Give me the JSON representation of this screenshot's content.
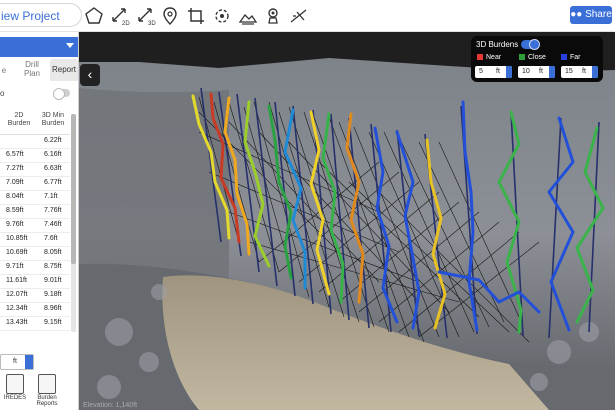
{
  "header": {
    "new_project_label": "iew Project",
    "share_label": "Share",
    "tools": [
      "polygon-tool-icon",
      "measure-2d-icon",
      "measure-3d-icon",
      "pin-icon",
      "crop-icon",
      "rotate-icon",
      "terrain-icon",
      "blast-icon",
      "slope-icon"
    ],
    "tool_labels": {
      "measure2d": "2D",
      "measure3d": "3D"
    }
  },
  "sidebar": {
    "tabs": [
      {
        "label": "e"
      },
      {
        "label": "Drill Plan"
      },
      {
        "label": "Report"
      }
    ],
    "toggle_label": "o",
    "table": {
      "headers": [
        "2D Burden",
        "3D Min Burden"
      ],
      "rows": [
        [
          "",
          "6.22ft"
        ],
        [
          "6.57ft",
          "6.16ft"
        ],
        [
          "7.27ft",
          "6.63ft"
        ],
        [
          "7.09ft",
          "6.77ft"
        ],
        [
          "8.04ft",
          "7.1ft"
        ],
        [
          "8.59ft",
          "7.76ft"
        ],
        [
          "9.76ft",
          "7.46ft"
        ],
        [
          "10.85ft",
          "7.6ft"
        ],
        [
          "10.69ft",
          "8.05ft"
        ],
        [
          "9.71ft",
          "8.75ft"
        ],
        [
          "11.61ft",
          "9.01ft"
        ],
        [
          "12.07ft",
          "9.18ft"
        ],
        [
          "12.34ft",
          "8.96ft"
        ],
        [
          "13.43ft",
          "9.15ft"
        ]
      ]
    },
    "unit_value": "ft",
    "bottom": [
      {
        "label": "IREDES"
      },
      {
        "label": "Burden Reports"
      }
    ]
  },
  "burden_panel": {
    "title": "3D Burdens",
    "legend": [
      {
        "label": "Near",
        "color": "#e53935"
      },
      {
        "label": "Close",
        "color": "#2e9e3a"
      },
      {
        "label": "Far",
        "color": "#2740e0"
      }
    ],
    "inputs": [
      {
        "value": "5",
        "unit": "ft"
      },
      {
        "value": "10",
        "unit": "ft"
      },
      {
        "value": "15",
        "unit": "ft"
      }
    ]
  },
  "status_text": "Elevation: 1,140ft"
}
